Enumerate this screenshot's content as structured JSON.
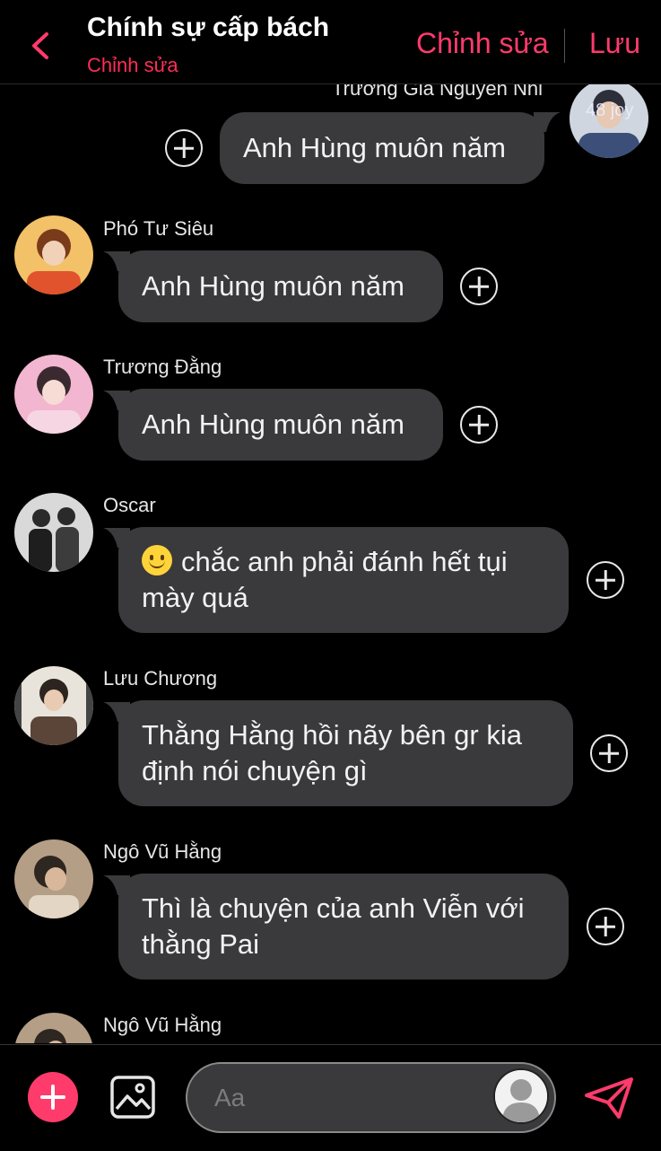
{
  "header": {
    "title": "Chính sự cấp bách",
    "subtitle": "Chỉnh sửa",
    "edit_label": "Chỉnh sửa",
    "save_label": "Lưu",
    "accent_color": "#ff3b6b"
  },
  "messages": [
    {
      "sender": "Trương Gia Nguyên Nhi",
      "text": "Anh Hùng muôn năm",
      "side": "right",
      "avatar_watermark": "48 joy"
    },
    {
      "sender": "Phó Tư Siêu",
      "text": "Anh Hùng muôn năm",
      "side": "left"
    },
    {
      "sender": "Trương Đằng",
      "text": "Anh Hùng muôn năm",
      "side": "left"
    },
    {
      "sender": "Oscar",
      "text": "chắc anh phải đánh hết tụi mày quá",
      "emoji": "slightly-smiling-face",
      "side": "left"
    },
    {
      "sender": "Lưu Chương",
      "text": "Thằng Hằng hồi nãy bên gr kia định nói chuyện gì",
      "side": "left"
    },
    {
      "sender": "Ngô Vũ Hằng",
      "text": "Thì là chuyện của anh Viễn với thằng Pai",
      "side": "left"
    },
    {
      "sender": "Ngô Vũ Hằng",
      "text": "",
      "side": "left"
    }
  ],
  "composer": {
    "placeholder": "Aa",
    "add_icon": "plus-icon",
    "image_icon": "image-icon",
    "send_icon": "send-icon"
  }
}
